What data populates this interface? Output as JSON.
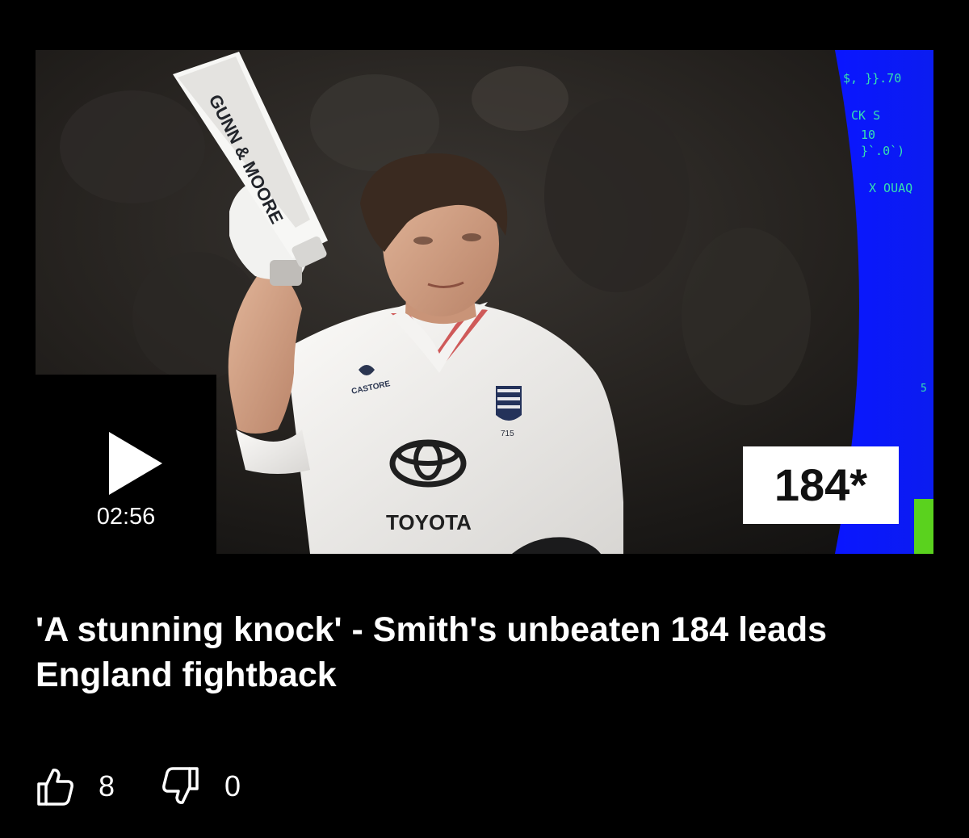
{
  "video": {
    "duration": "02:56",
    "score_badge": "184*",
    "scoreboard_lines": [
      "$, }}.70",
      "CK S",
      "10",
      "}`.0`)",
      "X OUAQ",
      "5"
    ]
  },
  "photo": {
    "shirt_sponsor": "TOYOTA",
    "kit_brand": "CASTORE",
    "badge_number": "715",
    "bat_brand": "GUNN & MOORE"
  },
  "article": {
    "headline": "'A stunning knock' - Smith's unbeaten 184 leads England fightback"
  },
  "reactions": {
    "likes": "8",
    "dislikes": "0"
  },
  "colors": {
    "background": "#000000",
    "scoreboard_blue": "#0a16ff",
    "scoreboard_text": "#35e0b0",
    "scoreboard_bar": "#5ad21e"
  },
  "icons": [
    "play-icon",
    "thumbs-up-icon",
    "thumbs-down-icon"
  ]
}
